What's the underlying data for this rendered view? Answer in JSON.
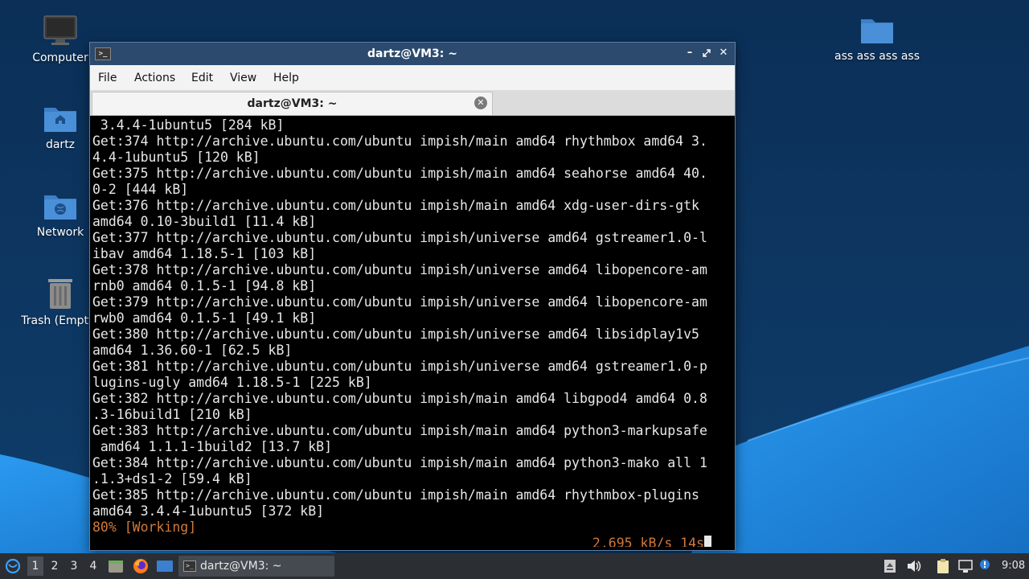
{
  "desktop": {
    "icons": [
      {
        "label": "Computer"
      },
      {
        "label": "dartz"
      },
      {
        "label": "Network"
      },
      {
        "label": "Trash (Empty)"
      },
      {
        "label": "ass ass ass ass"
      }
    ]
  },
  "window": {
    "title": "dartz@VM3: ~",
    "menu": [
      "File",
      "Actions",
      "Edit",
      "View",
      "Help"
    ],
    "tab_label": "dartz@VM3: ~",
    "terminal_lines": [
      " 3.4.4-1ubuntu5 [284 kB]",
      "Get:374 http://archive.ubuntu.com/ubuntu impish/main amd64 rhythmbox amd64 3.",
      "4.4-1ubuntu5 [120 kB]",
      "Get:375 http://archive.ubuntu.com/ubuntu impish/main amd64 seahorse amd64 40.",
      "0-2 [444 kB]",
      "Get:376 http://archive.ubuntu.com/ubuntu impish/main amd64 xdg-user-dirs-gtk",
      "amd64 0.10-3build1 [11.4 kB]",
      "Get:377 http://archive.ubuntu.com/ubuntu impish/universe amd64 gstreamer1.0-l",
      "ibav amd64 1.18.5-1 [103 kB]",
      "Get:378 http://archive.ubuntu.com/ubuntu impish/universe amd64 libopencore-am",
      "rnb0 amd64 0.1.5-1 [94.8 kB]",
      "Get:379 http://archive.ubuntu.com/ubuntu impish/universe amd64 libopencore-am",
      "rwb0 amd64 0.1.5-1 [49.1 kB]",
      "Get:380 http://archive.ubuntu.com/ubuntu impish/universe amd64 libsidplay1v5",
      "amd64 1.36.60-1 [62.5 kB]",
      "Get:381 http://archive.ubuntu.com/ubuntu impish/universe amd64 gstreamer1.0-p",
      "lugins-ugly amd64 1.18.5-1 [225 kB]",
      "Get:382 http://archive.ubuntu.com/ubuntu impish/main amd64 libgpod4 amd64 0.8",
      ".3-16build1 [210 kB]",
      "Get:383 http://archive.ubuntu.com/ubuntu impish/main amd64 python3-markupsafe",
      " amd64 1.1.1-1build2 [13.7 kB]",
      "Get:384 http://archive.ubuntu.com/ubuntu impish/main amd64 python3-mako all 1",
      ".1.3+ds1-2 [59.4 kB]",
      "Get:385 http://archive.ubuntu.com/ubuntu impish/main amd64 rhythmbox-plugins",
      "amd64 3.4.4-1ubuntu5 [372 kB]"
    ],
    "status_left": "80% [Working]",
    "status_right": "2,695 kB/s 14s"
  },
  "taskbar": {
    "workspaces": [
      "1",
      "2",
      "3",
      "4"
    ],
    "task_label": "dartz@VM3: ~",
    "clock": "9:08"
  },
  "colors": {
    "desktop_dark": "#0b2f57",
    "desktop_light": "#1e86d6",
    "titlebar": "#2b4a6d",
    "status_orange": "#d07a3a",
    "folder_blue": "#4a90d9"
  }
}
